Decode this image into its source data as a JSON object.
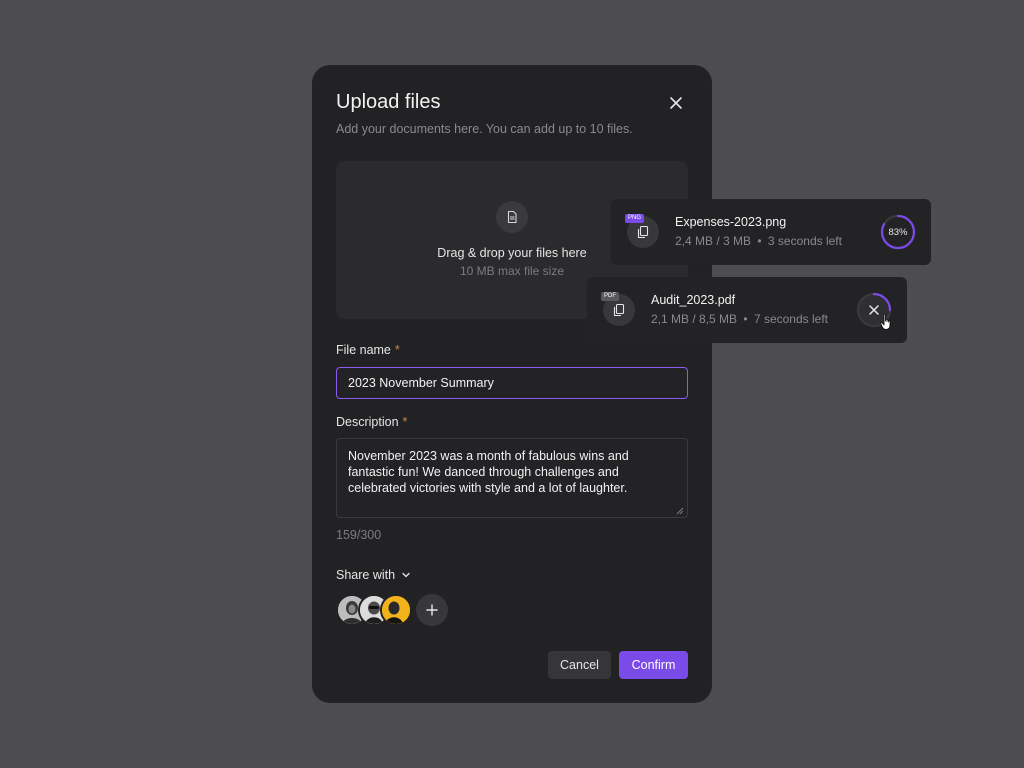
{
  "modal": {
    "title": "Upload files",
    "subtitle": "Add your documents here. You can add up to 10 files.",
    "dropzone": {
      "text": "Drag & drop your files here",
      "subtext": "10 MB max file size",
      "icon": "document-icon"
    },
    "file_name": {
      "label": "File name",
      "required_mark": "*",
      "value": "2023 November Summary"
    },
    "description": {
      "label": "Description",
      "required_mark": "*",
      "value": "November 2023 was a month of fabulous wins and fantastic fun! We danced through challenges and celebrated victories with style and a lot of laughter.",
      "counter": "159/300"
    },
    "share": {
      "label": "Share with",
      "avatars": [
        "avatar-1",
        "avatar-2",
        "avatar-3"
      ]
    },
    "buttons": {
      "cancel": "Cancel",
      "confirm": "Confirm"
    }
  },
  "uploads": [
    {
      "name": "Expenses-2023.png",
      "size": "2,4 MB / 3 MB",
      "separator": "•",
      "time": "3 seconds left",
      "tag": "PNG",
      "progress_percent": 83,
      "progress_label": "83%"
    },
    {
      "name": "Audit_2023.pdf",
      "size": "2,1 MB / 8,5 MB",
      "separator": "•",
      "time": "7 seconds left",
      "tag": "PDF",
      "progress_percent": 25
    }
  ],
  "colors": {
    "accent": "#7b4bea",
    "background": "#4d4d4f",
    "surface": "#222224",
    "required": "#c98a4a"
  }
}
